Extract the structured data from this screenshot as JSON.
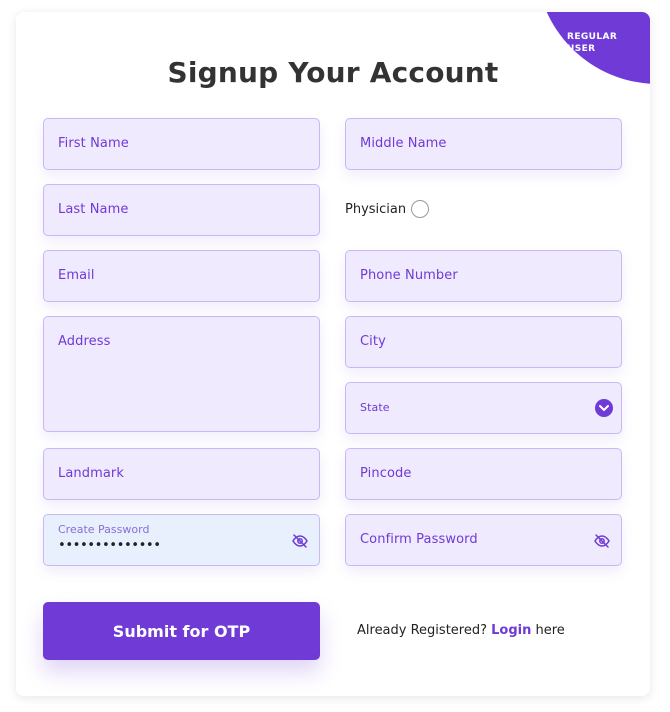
{
  "badge": {
    "label": "REGULAR USER"
  },
  "title": "Signup Your Account",
  "form": {
    "first_name": "First Name",
    "middle_name": "Middle Name",
    "last_name": "Last Name",
    "physician": "Physician",
    "email": "Email",
    "phone_number": "Phone Number",
    "address": "Address",
    "city": "City",
    "state": "State",
    "landmark": "Landmark",
    "pincode": "Pincode",
    "create_password_label": "Create Password",
    "create_password_value": "••••••••••••••",
    "confirm_password": "Confirm Password"
  },
  "actions": {
    "submit_label": "Submit for OTP",
    "already_registered": "Already Registered?",
    "login": "Login",
    "here": "here"
  },
  "colors": {
    "accent": "#6f3ad6",
    "field_bg": "#efeafe",
    "field_border": "#c9b8f7",
    "active_bg": "#e8effd"
  },
  "icons": {
    "password_visibility": "eye-off-icon",
    "state_dropdown": "chevron-down-icon",
    "physician_toggle": "radio-icon"
  }
}
